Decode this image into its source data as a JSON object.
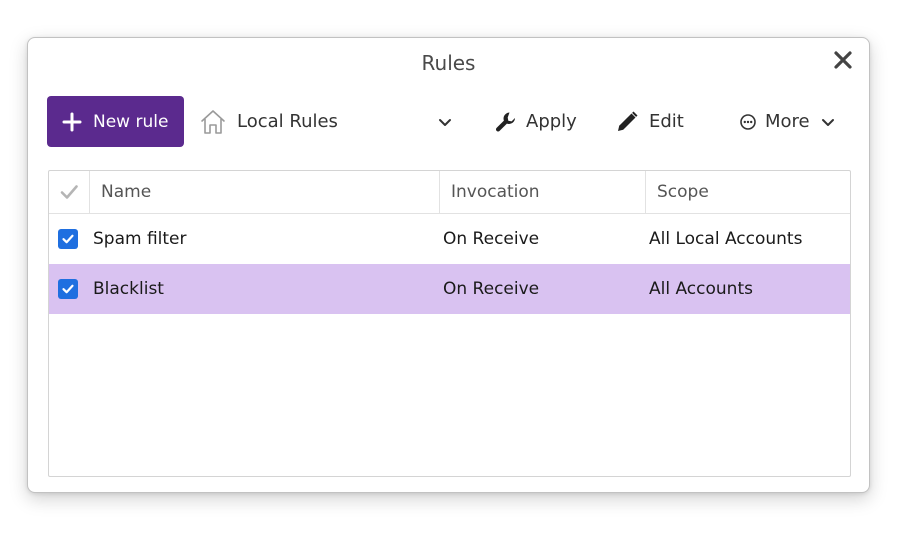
{
  "dialog": {
    "title": "Rules"
  },
  "toolbar": {
    "new_rule_label": "New rule",
    "rule_set_label": "Local Rules",
    "apply_label": "Apply",
    "edit_label": "Edit",
    "more_label": "More"
  },
  "table": {
    "columns": [
      "Name",
      "Invocation",
      "Scope"
    ],
    "rows": [
      {
        "enabled": true,
        "name": "Spam filter",
        "invocation": "On Receive",
        "scope": "All Local Accounts",
        "selected": false
      },
      {
        "enabled": true,
        "name": "Blacklist",
        "invocation": "On Receive",
        "scope": "All Accounts",
        "selected": true
      }
    ]
  },
  "colors": {
    "primary_button": "#5b2a8e",
    "selected_row": "#d9c2f1",
    "checkbox": "#1f6fe0"
  },
  "icons": {
    "close": "close-icon",
    "new_rule": "plus-icon",
    "rule_set": "home-icon",
    "dropdown": "chevron-down-icon",
    "apply": "wrench-icon",
    "edit": "pencil-icon",
    "more": "more-icon",
    "header_check": "checkmark-icon",
    "row_check": "checkbox-checked-icon"
  }
}
